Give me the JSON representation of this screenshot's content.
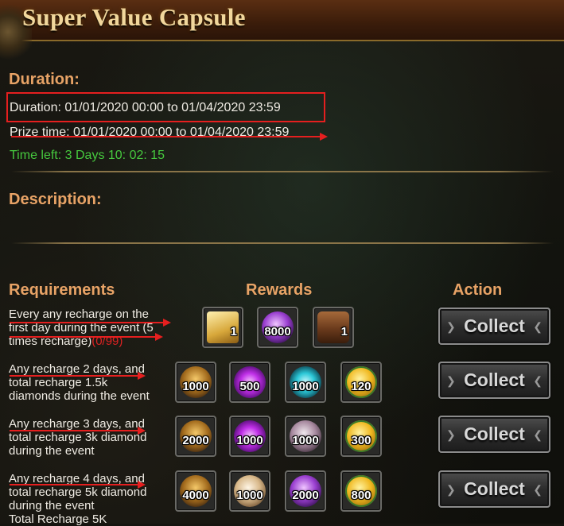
{
  "header": {
    "title": "Super Value Capsule"
  },
  "duration": {
    "heading": "Duration:",
    "duration_line": "Duration: 01/01/2020 00:00 to 01/04/2020 23:59",
    "prize_line": "Prize time: 01/01/2020 00:00 to 01/04/2020 23:59",
    "time_left": "Time left: 3 Days  10: 02: 15"
  },
  "description": {
    "heading": "Description:"
  },
  "columns": {
    "requirements": "Requirements",
    "rewards": "Rewards",
    "action": "Action"
  },
  "tiers": [
    {
      "req_lines": [
        "Every any recharge on the",
        "first day during the event (5",
        "times recharge)"
      ],
      "progress": "(0/99)",
      "rewards": [
        {
          "icon": "scroll-icon",
          "qty": "1"
        },
        {
          "icon": "purple-gem-icon",
          "qty": "8000"
        },
        {
          "icon": "treasure-chest-icon",
          "qty": "1"
        }
      ],
      "action": "Collect"
    },
    {
      "req_lines": [
        "Any recharge 2 days, and",
        "total recharge 1.5k",
        "diamonds during the event"
      ],
      "rewards": [
        {
          "icon": "gold-rune-icon",
          "qty": "1000"
        },
        {
          "icon": "purple-orb-icon",
          "qty": "500"
        },
        {
          "icon": "cyan-orb-icon",
          "qty": "1000"
        },
        {
          "icon": "gold-coin-icon",
          "qty": "120"
        }
      ],
      "action": "Collect"
    },
    {
      "req_lines": [
        "Any recharge 3 days, and",
        "total recharge 3k diamond",
        "during the event"
      ],
      "rewards": [
        {
          "icon": "gold-rune-icon",
          "qty": "2000"
        },
        {
          "icon": "purple-orb-icon",
          "qty": "1000"
        },
        {
          "icon": "silver-ore-icon",
          "qty": "1000"
        },
        {
          "icon": "gold-coin-icon",
          "qty": "300"
        }
      ],
      "action": "Collect"
    },
    {
      "req_lines": [
        "Any recharge 4 days, and",
        "total recharge 5k diamond",
        "during the event",
        "Total Recharge 5K"
      ],
      "rewards": [
        {
          "icon": "gold-rune-icon",
          "qty": "4000"
        },
        {
          "icon": "pearl-orb-icon",
          "qty": "1000"
        },
        {
          "icon": "purple-crystal-icon",
          "qty": "2000"
        },
        {
          "icon": "gold-coin-icon",
          "qty": "800"
        }
      ],
      "action": "Collect"
    }
  ],
  "colors": {
    "heading": "#e8a366",
    "time_left": "#46c83e",
    "annotation_red": "#e51f1f",
    "progress_red": "#dd2222"
  }
}
